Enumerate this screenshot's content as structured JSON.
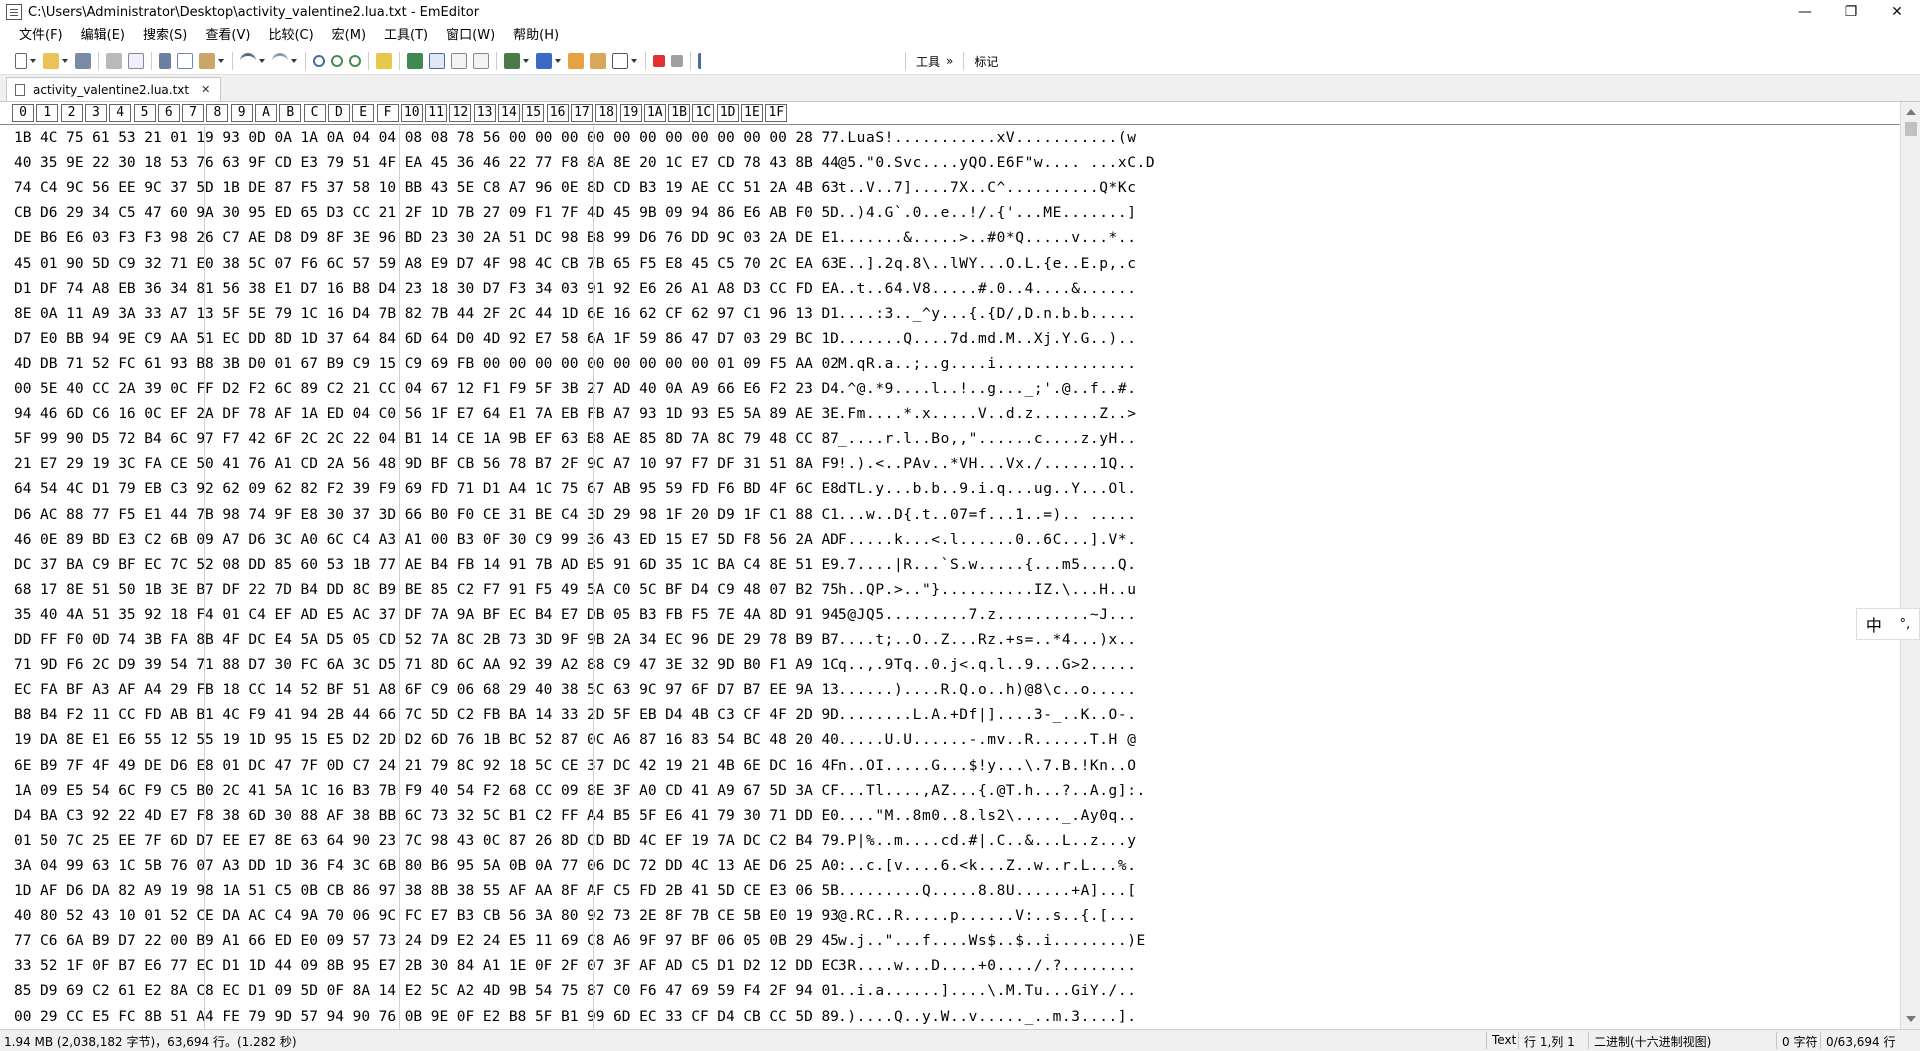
{
  "window": {
    "title": "C:\\Users\\Administrator\\Desktop\\activity_valentine2.lua.txt - EmEditor",
    "controls": {
      "minimize": "—",
      "maximize": "❐",
      "close": "✕"
    }
  },
  "menu": [
    "文件(F)",
    "编辑(E)",
    "搜索(S)",
    "查看(V)",
    "比较(C)",
    "宏(M)",
    "工具(T)",
    "窗口(W)",
    "帮助(H)"
  ],
  "toolbar": {
    "tools_label": "工具",
    "overflow": "»",
    "marks_label": "标记"
  },
  "tab": {
    "label": "activity_valentine2.lua.txt",
    "close": "✕"
  },
  "ruler": [
    "0",
    "1",
    "2",
    "3",
    "4",
    "5",
    "6",
    "7",
    "8",
    "9",
    "A",
    "B",
    "C",
    "D",
    "E",
    "F",
    "10",
    "11",
    "12",
    "13",
    "14",
    "15",
    "16",
    "17",
    "18",
    "19",
    "1A",
    "1B",
    "1C",
    "1D",
    "1E",
    "1F"
  ],
  "rows": [
    {
      "hex": "1B 4C 75 61 53 21 01 19 93 0D 0A 1A 0A 04 04 08 08 78 56 00 00 00 00 00 00 00 00 00 00 00 28 77",
      "text": ".LuaS!...........xV...........(w"
    },
    {
      "hex": "40 35 9E 22 30 18 53 76 63 9F CD E3 79 51 4F EA 45 36 46 22 77 F8 8A 8E 20 1C E7 CD 78 43 8B 44",
      "text": "@5.\"0.Svc....yQO.E6F\"w.... ...xC.D"
    },
    {
      "hex": "74 C4 9C 56 EE 9C 37 5D 1B DE 87 F5 37 58 10 BB 43 5E C8 A7 96 0E 8D CD B3 19 AE CC 51 2A 4B 63",
      "text": "t..V..7]....7X..C^..........Q*Kc"
    },
    {
      "hex": "CB D6 29 34 C5 47 60 9A 30 95 ED 65 D3 CC 21 2F 1D 7B 27 09 F1 7F 4D 45 9B 09 94 86 E6 AB F0 5D",
      "text": "..)4.G`.0..e..!/.{'...ME.......]"
    },
    {
      "hex": "DE B6 E6 03 F3 F3 98 26 C7 AE D8 D9 8F 3E 96 BD 23 30 2A 51 DC 98 B8 99 D6 76 DD 9C 03 2A DE E1",
      "text": ".......&.....>..#0*Q.....v...*.."
    },
    {
      "hex": "45 01 90 5D C9 32 71 E0 38 5C 07 F6 6C 57 59 A8 E9 D7 4F 98 4C CB 7B 65 F5 E8 45 C5 70 2C EA 63",
      "text": "E..].2q.8\\..lWY...O.L.{e..E.p,.c"
    },
    {
      "hex": "D1 DF 74 A8 EB 36 34 81 56 38 E1 D7 16 B8 D4 23 18 30 D7 F3 34 03 91 92 E6 26 A1 A8 D3 CC FD EA",
      "text": "..t..64.V8.....#.0..4....&......"
    },
    {
      "hex": "8E 0A 11 A9 3A 33 A7 13 5F 5E 79 1C 16 D4 7B 82 7B 44 2F 2C 44 1D 6E 16 62 CF 62 97 C1 96 13 D1",
      "text": "....:3.._^y...{.{D/,D.n.b.b....."
    },
    {
      "hex": "D7 E0 BB 94 9E C9 AA 51 EC DD 8D 1D 37 64 84 6D 64 D0 4D 92 E7 58 6A 1F 59 86 47 D7 03 29 BC 1D",
      "text": ".......Q....7d.md.M..Xj.Y.G..).."
    },
    {
      "hex": "4D DB 71 52 FC 61 93 B8 3B D0 01 67 B9 C9 15 C9 69 FB 00 00 00 00 00 00 00 00 00 01 09 F5 AA 02",
      "text": "M.qR.a..;..g....i..............."
    },
    {
      "hex": "00 5E 40 CC 2A 39 0C FF D2 F2 6C 89 C2 21 CC 04 67 12 F1 F9 5F 3B 27 AD 40 0A A9 66 E6 F2 23 D4",
      "text": ".^@.*9....l..!..g..._;'.@..f..#."
    },
    {
      "hex": "94 46 6D C6 16 0C EF 2A DF 78 AF 1A ED 04 C0 56 1F E7 64 E1 7A EB FB A7 93 1D 93 E5 5A 89 AE 3E",
      "text": ".Fm....*.x.....V..d.z.......Z..>"
    },
    {
      "hex": "5F 99 90 D5 72 B4 6C 97 F7 42 6F 2C 2C 22 04 B1 14 CE 1A 9B EF 63 B8 AE 85 8D 7A 8C 79 48 CC 87",
      "text": "_....r.l..Bo,,\"......c....z.yH.."
    },
    {
      "hex": "21 E7 29 19 3C FA CE 50 41 76 A1 CD 2A 56 48 9D BF CB 56 78 B7 2F 9C A7 10 97 F7 DF 31 51 8A F9",
      "text": "!.).<..PAv..*VH...Vx./......1Q.."
    },
    {
      "hex": "64 54 4C D1 79 EB C3 92 62 09 62 82 F2 39 F9 69 FD 71 D1 A4 1C 75 67 AB 95 59 FD F6 BD 4F 6C E8",
      "text": "dTL.y...b.b..9.i.q...ug..Y...Ol."
    },
    {
      "hex": "D6 AC 88 77 F5 E1 44 7B 98 74 9F E8 30 37 3D 66 B0 F0 CE 31 BE C4 3D 29 98 1F 20 D9 1F C1 88 C1",
      "text": "...w..D{.t..07=f...1..=).. ....."
    },
    {
      "hex": "46 0E 89 BD E3 C2 6B 09 A7 D6 3C A0 6C C4 A3 A1 00 B3 0F 30 C9 99 36 43 ED 15 E7 5D F8 56 2A AD",
      "text": "F.....k...<.l......0..6C...].V*."
    },
    {
      "hex": "DC 37 BA C9 BF EC 7C 52 08 DD 85 60 53 1B 77 AE B4 FB 14 91 7B AD B5 91 6D 35 1C BA C4 8E 51 E9",
      "text": ".7....|R...`S.w.....{...m5....Q."
    },
    {
      "hex": "68 17 8E 51 50 1B 3E B7 DF 22 7D B4 DD 8C B9 BE 85 C2 F7 91 F5 49 5A C0 5C BF D4 C9 48 07 B2 75",
      "text": "h..QP.>..\"}..........IZ.\\...H..u"
    },
    {
      "hex": "35 40 4A 51 35 92 18 F4 01 C4 EF AD E5 AC 37 DF 7A 9A BF EC B4 E7 DB 05 B3 FB F5 7E 4A 8D 91 94",
      "text": "5@JQ5.........7.z..........~J..."
    },
    {
      "hex": "DD FF F0 0D 74 3B FA 8B 4F DC E4 5A D5 05 CD 52 7A 8C 2B 73 3D 9F 9B 2A 34 EC 96 DE 29 78 B9 B7",
      "text": "....t;..O..Z...Rz.+s=..*4...)x.."
    },
    {
      "hex": "71 9D F6 2C D9 39 54 71 88 D7 30 FC 6A 3C D5 71 8D 6C AA 92 39 A2 88 C9 47 3E 32 9D B0 F1 A9 1C",
      "text": "q..,.9Tq..0.j<.q.l..9...G>2....."
    },
    {
      "hex": "EC FA BF A3 AF A4 29 FB 18 CC 14 52 BF 51 A8 6F C9 06 68 29 40 38 5C 63 9C 97 6F D7 B7 EE 9A 13",
      "text": "......)....R.Q.o..h)@8\\c..o....."
    },
    {
      "hex": "B8 B4 F2 11 CC FD AB B1 4C F9 41 94 2B 44 66 7C 5D C2 FB BA 14 33 2D 5F EB D4 4B C3 CF 4F 2D 9D",
      "text": "........L.A.+Df|]....3-_..K..O-."
    },
    {
      "hex": "19 DA 8E E1 E6 55 12 55 19 1D 95 15 E5 D2 2D D2 6D 76 1B BC 52 87 0C A6 87 16 83 54 BC 48 20 40",
      "text": ".....U.U......-.mv..R......T.H @"
    },
    {
      "hex": "6E B9 7F 4F 49 DE D6 E8 01 DC 47 7F 0D C7 24 21 79 8C 92 18 5C CE 37 DC 42 19 21 4B 6E DC 16 4F",
      "text": "n..OI.....G...$!y...\\.7.B.!Kn..O"
    },
    {
      "hex": "1A 09 E5 54 6C F9 C5 B0 2C 41 5A 1C 16 B3 7B F9 40 54 F2 68 CC 09 8E 3F A0 CD 41 A9 67 5D 3A CF",
      "text": "...Tl....,AZ...{.@T.h...?..A.g]:."
    },
    {
      "hex": "D4 BA C3 92 22 4D E7 F8 38 6D 30 88 AF 38 BB 6C 73 32 5C B1 C2 FF A4 B5 5F E6 41 79 30 71 DD E0",
      "text": "....\"M..8m0..8.ls2\\....._.Ay0q.."
    },
    {
      "hex": "01 50 7C 25 EE 7F 6D D7 EE E7 8E 63 64 90 23 7C 98 43 0C 87 26 8D CD BD 4C EF 19 7A DC C2 B4 79",
      "text": ".P|%..m....cd.#|.C..&...L..z...y"
    },
    {
      "hex": "3A 04 99 63 1C 5B 76 07 A3 DD 1D 36 F4 3C 6B 80 B6 95 5A 0B 0A 77 06 DC 72 DD 4C 13 AE D6 25 A0",
      "text": ":..c.[v....6.<k...Z..w..r.L...%."
    },
    {
      "hex": "1D AF D6 DA 82 A9 19 98 1A 51 C5 0B CB 86 97 38 8B 38 55 AF AA 8F AF C5 FD 2B 41 5D CE E3 06 5B",
      "text": ".........Q.....8.8U......+A]...["
    },
    {
      "hex": "40 80 52 43 10 01 52 CE DA AC C4 9A 70 06 9C FC E7 B3 CB 56 3A 80 92 73 2E 8F 7B CE 5B E0 19 93",
      "text": "@.RC..R.....p......V:..s..{.[..."
    },
    {
      "hex": "77 C6 6A B9 D7 22 00 B9 A1 66 ED E0 09 57 73 24 D9 E2 24 E5 11 69 C8 A6 9F 97 BF 06 05 0B 29 45",
      "text": "w.j..\"...f....Ws$..$..i........)E"
    },
    {
      "hex": "33 52 1F 0F B7 E6 77 EC D1 1D 44 09 8B 95 E7 2B 30 84 A1 1E 0F 2F 07 3F AF AD C5 D1 D2 12 DD EC",
      "text": "3R....w...D....+0..../.?........"
    },
    {
      "hex": "85 D9 69 C2 61 E2 8A C8 EC D1 09 5D 0F 8A 14 E2 5C A2 4D 9B 54 75 87 C0 F6 47 69 59 F4 2F 94 01",
      "text": "..i.a......]....\\.M.Tu...GiY./.."
    },
    {
      "hex": "00 29 CC E5 FC 8B 51 A4 FE 79 9D 57 94 90 76 0B 9E 0F E2 B8 5F B1 99 6D EC 33 CF D4 CB CC 5D 89",
      "text": ".)....Q..y.W..v....._..m.3....]."
    }
  ],
  "ime": {
    "lang": "中",
    "mode": "°,"
  },
  "status": {
    "left": "1.94 MB (2,038,182 字节)，63,694 行。(1.282 秒)",
    "mode": "Text",
    "position": "行 1,列 1",
    "encoding": "二进制(十六进制视图)",
    "chars": "0 字符",
    "lines": "0/63,694 行"
  },
  "colors": {
    "record_icon": "#e03030",
    "accent": "#1f6fd0"
  }
}
